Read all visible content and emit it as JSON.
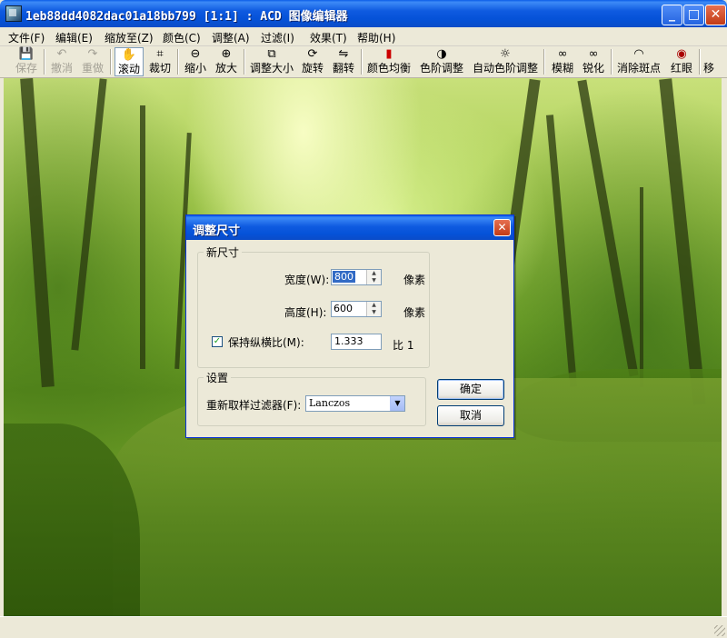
{
  "window": {
    "title": "1eb88dd4082dac01a18bb799 [1:1] : ACD 图像编辑器",
    "minimize": "_",
    "maximize": "□",
    "close": "✕"
  },
  "menu": [
    {
      "label": "文件(F)"
    },
    {
      "label": "编辑(E)"
    },
    {
      "label": "缩放至(Z)"
    },
    {
      "label": "颜色(C)"
    },
    {
      "label": "调整(A)"
    },
    {
      "label": "过滤(I)"
    },
    {
      "label": "效果(T)"
    },
    {
      "label": "帮助(H)"
    }
  ],
  "toolbar": {
    "save": {
      "label": "保存",
      "icon": "💾"
    },
    "undo": {
      "label": "撤消",
      "icon": "↶"
    },
    "redo": {
      "label": "重做",
      "icon": "↷"
    },
    "scroll": {
      "label": "滚动",
      "icon": "✋"
    },
    "crop": {
      "label": "裁切",
      "icon": "⌗"
    },
    "zoom_out": {
      "label": "缩小",
      "icon": "⊖"
    },
    "zoom_in": {
      "label": "放大",
      "icon": "⊕"
    },
    "resize": {
      "label": "调整大小",
      "icon": "⧉"
    },
    "rotate": {
      "label": "旋转",
      "icon": "⟳"
    },
    "flip": {
      "label": "翻转",
      "icon": "⇋"
    },
    "color_balance": {
      "label": "颜色均衡",
      "icon": "▮"
    },
    "levels": {
      "label": "色阶调整",
      "icon": "◑"
    },
    "auto_levels": {
      "label": "自动色阶调整",
      "icon": "☼"
    },
    "blur": {
      "label": "模糊",
      "icon": "∞"
    },
    "sharpen": {
      "label": "锐化",
      "icon": "∞"
    },
    "despeckle": {
      "label": "消除斑点",
      "icon": "◠"
    },
    "red_eye": {
      "label": "红眼",
      "icon": "◉"
    },
    "more": {
      "label": "移",
      "icon": ""
    }
  },
  "dialog": {
    "title": "调整尺寸",
    "close": "✕",
    "new_size": {
      "legend": "新尺寸",
      "width_label": "宽度(W):",
      "width_value": "800",
      "width_unit": "像素",
      "height_label": "高度(H):",
      "height_value": "600",
      "height_unit": "像素",
      "keep_ratio_label": "保持纵横比(M):",
      "keep_ratio_checked": true,
      "check_mark": "✓",
      "ratio_value": "1.333",
      "ratio_suffix": "比 1"
    },
    "settings": {
      "legend": "设置",
      "filter_label": "重新取样过滤器(F):",
      "filter_value": "Lanczos",
      "dropdown_arrow": "▼"
    },
    "ok": "确定",
    "cancel": "取消"
  },
  "colors": {
    "titlebar": "#0A5CE8",
    "selection": "#316AC5",
    "face": "#ECE9D8"
  }
}
